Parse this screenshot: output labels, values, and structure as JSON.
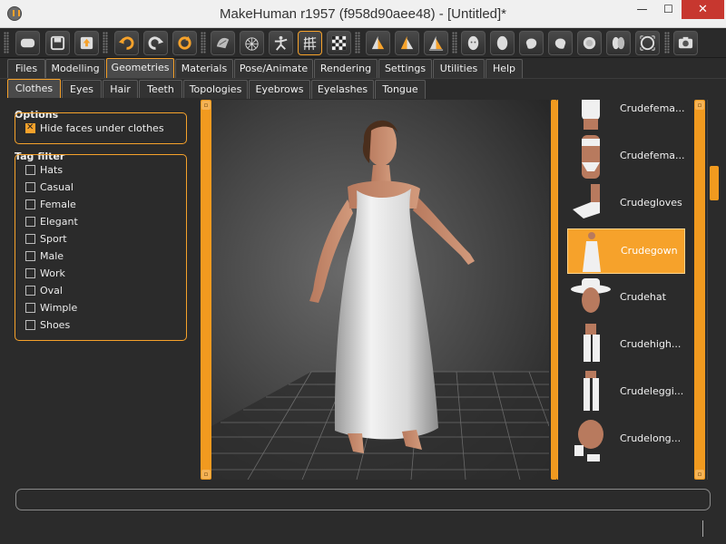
{
  "window": {
    "title": "MakeHuman r1957 (f958d90aee48) - [Untitled]*",
    "minimize": "—",
    "maximize": "☐",
    "close": "✕"
  },
  "toolbar": {
    "buttons": [
      "undo-icon",
      "redo-icon",
      "reset-icon",
      "smooth-icon",
      "wireframe-icon",
      "pose-icon",
      "grid-icon",
      "checker-icon",
      "front-view-icon",
      "side-view-icon",
      "back-view-icon",
      "face-icon",
      "head-icon",
      "left-icon",
      "right-icon",
      "top-icon",
      "bottom-icon",
      "reset-camera-icon",
      "screenshot-icon"
    ]
  },
  "main_tabs": [
    "Files",
    "Modelling",
    "Geometries",
    "Materials",
    "Pose/Animate",
    "Rendering",
    "Settings",
    "Utilities",
    "Help"
  ],
  "main_tab_active": "Geometries",
  "sub_tabs": [
    "Clothes",
    "Eyes",
    "Hair",
    "Teeth",
    "Topologies",
    "Eyebrows",
    "Eyelashes",
    "Tongue"
  ],
  "sub_tab_active": "Clothes",
  "options": {
    "title": "Options",
    "hide_faces_label": "Hide faces under clothes",
    "hide_faces_checked": true
  },
  "tag_filter": {
    "title": "Tag filter",
    "tags": [
      "Hats",
      "Casual",
      "Female",
      "Elegant",
      "Sport",
      "Male",
      "Work",
      "Oval",
      "Wimple",
      "Shoes"
    ]
  },
  "clothes_list": {
    "items": [
      "Crudefema...",
      "Crudefema...",
      "Crudegloves",
      "Crudegown",
      "Crudehat",
      "Crudehigh...",
      "Crudeleggi...",
      "Crudelong..."
    ],
    "selected": "Crudegown"
  },
  "slider_caps": [
    "▫",
    "▫"
  ],
  "status": {
    "text": ""
  },
  "colors": {
    "accent": "#f6a22b",
    "background": "#2b2b2b",
    "close": "#c7372f"
  }
}
